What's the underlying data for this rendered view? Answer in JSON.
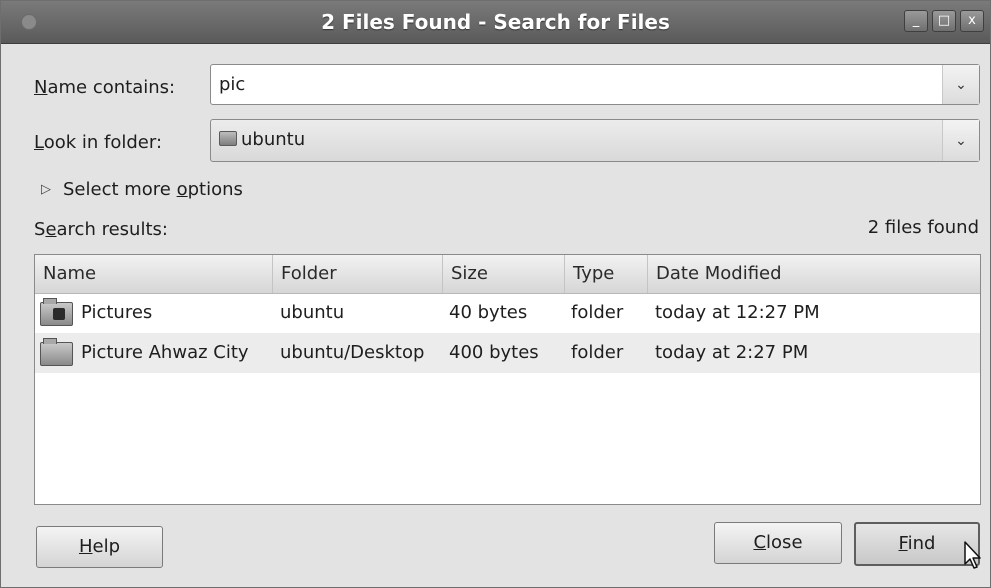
{
  "window": {
    "title": "2 Files Found - Search for Files",
    "controls": {
      "minimize": "_",
      "maximize": "□",
      "close": "x"
    }
  },
  "name_contains": {
    "label_prefix": "",
    "label_mnemonic": "N",
    "label_rest": "ame contains:",
    "value": "pic"
  },
  "look_in": {
    "label_mnemonic": "L",
    "label_rest": "ook in folder:",
    "value": "ubuntu"
  },
  "more_options": {
    "label_before": "Select more ",
    "label_mnemonic": "o",
    "label_after": "ptions"
  },
  "results": {
    "label_before": "S",
    "label_mnemonic": "e",
    "label_after": "arch results:",
    "count_text": "2 files found",
    "columns": [
      "Name",
      "Folder",
      "Size",
      "Type",
      "Date Modified"
    ],
    "rows": [
      {
        "name": "Pictures",
        "folder": "ubuntu",
        "size": "40 bytes",
        "type": "folder",
        "date": "today at 12:27 PM"
      },
      {
        "name": "Picture Ahwaz City",
        "folder": "ubuntu/Desktop",
        "size": "400 bytes",
        "type": "folder",
        "date": "today at 2:27 PM"
      }
    ]
  },
  "buttons": {
    "help": {
      "mnemonic": "H",
      "rest": "elp"
    },
    "close": {
      "mnemonic": "C",
      "rest": "lose"
    },
    "find": {
      "mnemonic": "F",
      "rest": "ind"
    }
  }
}
